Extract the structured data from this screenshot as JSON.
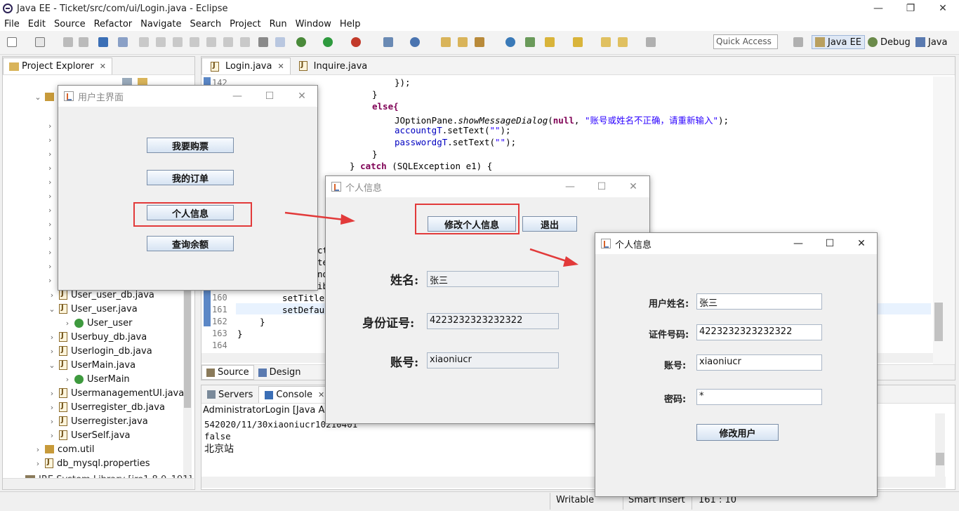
{
  "window": {
    "title": "Java EE - Ticket/src/com/ui/Login.java - Eclipse"
  },
  "menu": [
    "File",
    "Edit",
    "Source",
    "Refactor",
    "Navigate",
    "Search",
    "Project",
    "Run",
    "Window",
    "Help"
  ],
  "toolbar": {
    "quick_access": "Quick Access",
    "perspectives": [
      "Java EE",
      "Debug",
      "Java"
    ]
  },
  "explorer": {
    "title": "Project Explorer",
    "rows": [
      {
        "label": "User_user_db.java",
        "type": "java",
        "indent": 1,
        "expanded": false
      },
      {
        "label": "User_user.java",
        "type": "java",
        "indent": 1,
        "expanded": true
      },
      {
        "label": "User_user",
        "type": "class",
        "indent": 2,
        "expanded": false
      },
      {
        "label": "Userbuy_db.java",
        "type": "java",
        "indent": 1,
        "expanded": false
      },
      {
        "label": "Userlogin_db.java",
        "type": "java",
        "indent": 1,
        "expanded": false
      },
      {
        "label": "UserMain.java",
        "type": "java",
        "indent": 1,
        "expanded": true
      },
      {
        "label": "UserMain",
        "type": "class",
        "indent": 2,
        "expanded": false
      },
      {
        "label": "UsermanagementUI.java",
        "type": "java",
        "indent": 1,
        "expanded": false
      },
      {
        "label": "Userregister_db.java",
        "type": "java",
        "indent": 1,
        "expanded": false
      },
      {
        "label": "Userregister.java",
        "type": "java",
        "indent": 1,
        "expanded": false
      },
      {
        "label": "UserSelf.java",
        "type": "java",
        "indent": 1,
        "expanded": false
      },
      {
        "label": "com.util",
        "type": "package",
        "indent": 0,
        "expanded": false
      },
      {
        "label": "db_mysql.properties",
        "type": "file",
        "indent": 0,
        "expanded": false
      }
    ],
    "truncated_row": "JRE System Library [jre1.8.0_191]"
  },
  "editor": {
    "tabs": [
      "Login.java",
      "Inquire.java"
    ],
    "bottom_tabs": [
      "Source",
      "Design"
    ],
    "line_numbers": [
      "142",
      "160",
      "161",
      "162",
      "163",
      "164"
    ],
    "code": {
      "l1": "});",
      "l2": "}",
      "l3": "else{",
      "l4a": "JOptionPane.",
      "l4b": "showMessageDialog",
      "l4c": "(",
      "l4d": "null",
      "l4e": ", ",
      "l4f": "\"账号或姓名不正确，请重新输入\"",
      "l4g": ");",
      "l5a": "accountgT",
      "l5b": ".setText(",
      "l5c": "\"\"",
      "l5d": ");",
      "l6a": "passwordgT",
      "l6b": ".setText(",
      "l6c": "\"\"",
      "l6d": ");",
      "l7": "}",
      "l8a": "} ",
      "l8b": "catch",
      "l8c": " (SQLException e1) {",
      "l9": "setTitle",
      "l10": "setDefau",
      "l11": "}",
      "l12": "}",
      "frag1": "ct",
      "frag2": "te",
      "frag3": "nd",
      "frag4": "ib"
    }
  },
  "console": {
    "tabs": [
      "Servers",
      "Console"
    ],
    "header": "AdministratorLogin [Java Appl",
    "lines": [
      "542020/11/30xiaoniucr10210401",
      "false",
      "北京站"
    ]
  },
  "status": {
    "writable": "Writable",
    "insert": "Smart Insert",
    "position": "161 : 10"
  },
  "win_main": {
    "title": "用户主界面",
    "buttons": [
      "我要购票",
      "我的订单",
      "个人信息",
      "查询余额"
    ]
  },
  "win_info": {
    "title": "个人信息",
    "edit_button": "修改个人信息",
    "exit_button": "退出",
    "labels": [
      "姓名:",
      "身份证号:",
      "账号:"
    ],
    "values": [
      "张三",
      "4223232323232322",
      "xiaoniucr"
    ]
  },
  "win_edit": {
    "title": "个人信息",
    "labels": [
      "用户姓名:",
      "证件号码:",
      "账号:",
      "密码:"
    ],
    "values": [
      "张三",
      "4223232323232322",
      "xiaoniucr",
      "*"
    ],
    "submit": "修改用户"
  }
}
